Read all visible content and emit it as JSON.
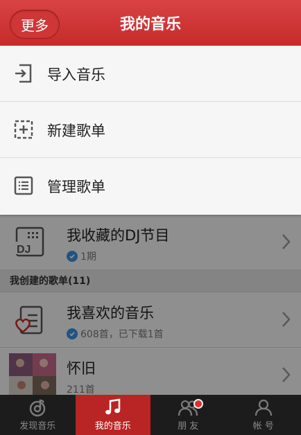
{
  "header": {
    "more_label": "更多",
    "title": "我的音乐"
  },
  "menu": {
    "items": [
      {
        "label": "导入音乐",
        "icon": "import-icon"
      },
      {
        "label": "新建歌单",
        "icon": "new-playlist-icon"
      },
      {
        "label": "管理歌单",
        "icon": "manage-playlist-icon"
      }
    ]
  },
  "list": {
    "dj_row": {
      "name": "我收藏的DJ节目",
      "sub": "1期",
      "icon": "dj-icon"
    },
    "section_label": "我创建的歌单(11)",
    "fav_row": {
      "name": "我喜欢的音乐",
      "sub": "608首，已下载1首",
      "icon": "heart-list-icon"
    },
    "old_row": {
      "name": "怀旧",
      "sub": "211首"
    }
  },
  "tabbar": {
    "tabs": [
      {
        "label": "发现音乐",
        "icon": "discover-icon",
        "active": false
      },
      {
        "label": "我的音乐",
        "icon": "music-note-icon",
        "active": true
      },
      {
        "label": "朋 友",
        "icon": "friends-icon",
        "active": false
      },
      {
        "label": "帐 号",
        "icon": "account-icon",
        "active": false
      }
    ]
  },
  "colors": {
    "header_red": "#d03a3a",
    "active_tab": "#b92424",
    "check_blue": "#3a8de0"
  }
}
